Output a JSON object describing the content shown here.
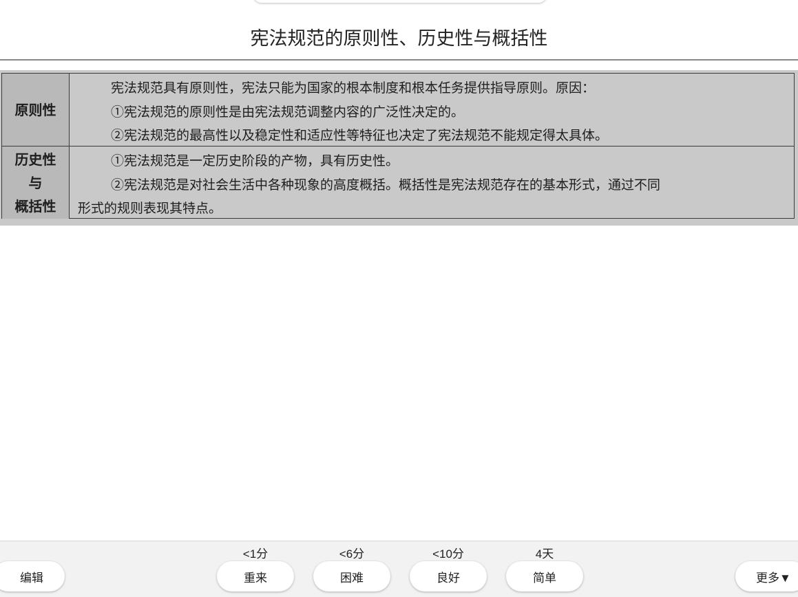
{
  "card": {
    "title": "宪法规范的原则性、历史性与概括性",
    "table": {
      "rows": [
        {
          "head": [
            "原则性"
          ],
          "lines": [
            "宪法规范具有原则性，宪法只能为国家的根本制度和根本任务提供指导原则。原因：",
            "①宪法规范的原则性是由宪法规范调整内容的广泛性决定的。",
            "②宪法规范的最高性以及稳定性和适应性等特征也决定了宪法规范不能规定得太具体。"
          ]
        },
        {
          "head": [
            "历史性",
            "与",
            "概括性"
          ],
          "lines": [
            "①宪法规范是一定历史阶段的产物，具有历史性。",
            "②宪法规范是对社会生活中各种现象的高度概括。概括性是宪法规范存在的基本形式，通过不同",
            "形式的规则表现其特点。"
          ]
        }
      ]
    }
  },
  "answer_bar": {
    "edit_label": "编辑",
    "more_label": "更多▼",
    "buttons": [
      {
        "interval": "<1分",
        "label": "重来"
      },
      {
        "interval": "<6分",
        "label": "困难"
      },
      {
        "interval": "<10分",
        "label": "良好"
      },
      {
        "interval": "4天",
        "label": "简单"
      }
    ]
  }
}
